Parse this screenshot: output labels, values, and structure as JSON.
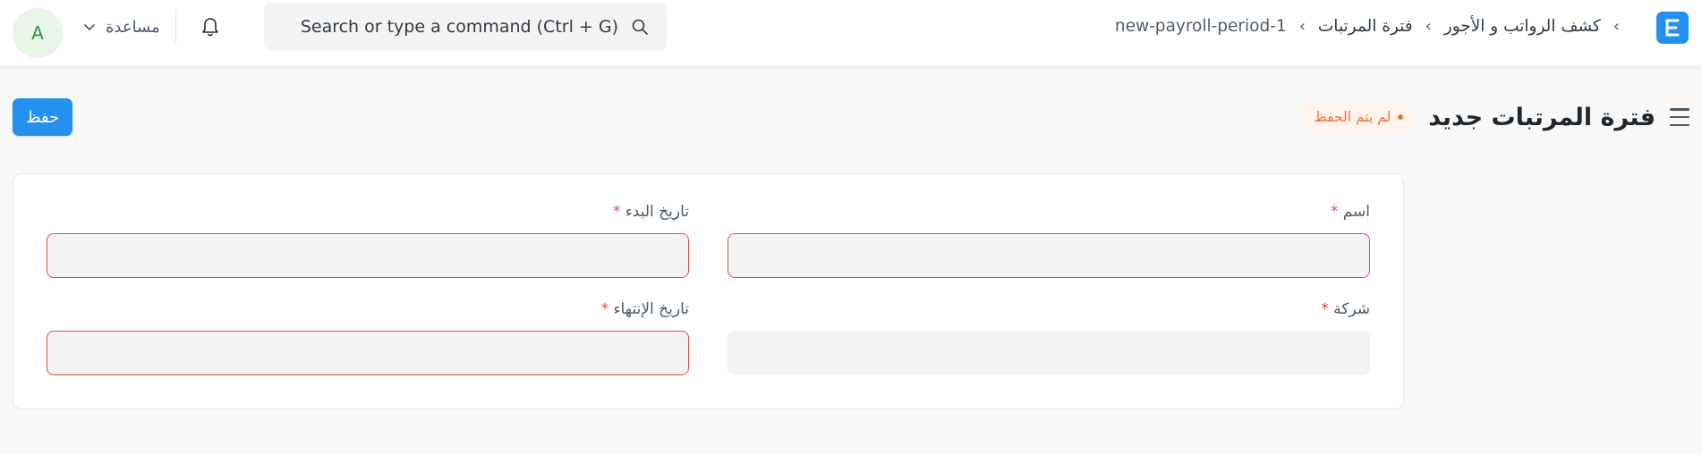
{
  "navbar": {
    "avatar_initial": "A",
    "help_label": "مساعدة",
    "search_placeholder": "Search or type a command (Ctrl + G)",
    "breadcrumb": [
      "كشف الرواتب و الأجور",
      "فترة المرتبات",
      "new-payroll-period-1"
    ],
    "breadcrumb_sep": "›",
    "logo_letter": "E",
    "accent_color": "#2490ef"
  },
  "page": {
    "title": "فترة المرتبات جديد",
    "status": "لم يتم الحفظ",
    "save_label": "حفظ",
    "status_color": "#e8783a"
  },
  "form": {
    "name_label": "اسم",
    "start_date_label": "تاريخ البدء",
    "company_label": "شركة",
    "end_date_label": "تاريخ الإنتهاء",
    "required_mark": "*",
    "name_value": "",
    "start_date_value": "",
    "company_value": "",
    "end_date_value": ""
  }
}
